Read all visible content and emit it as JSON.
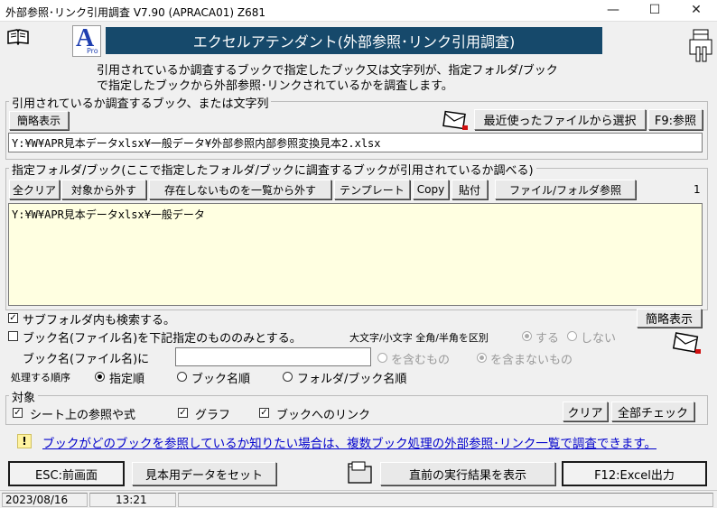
{
  "window": {
    "title": "外部参照･リンク引用調査 V7.90 (APRACA01)  Z681",
    "minimize": "—",
    "maximize": "☐",
    "close": "✕"
  },
  "header": {
    "logo_letter": "A",
    "logo_sub": "Pro",
    "banner": "エクセルアテンダント(外部参照･リンク引用調査)",
    "description_line1": "引用されているか調査するブックで指定したブック又は文字列が、指定フォルダ/ブック",
    "description_line2": "で指定したブックから外部参照･リンクされているかを調査します。"
  },
  "target_section": {
    "legend": "引用されているか調査するブック、または文字列",
    "simple_view_label": "簡略表示",
    "recent_files_label": "最近使ったファイルから選択",
    "browse_label": "F9:参照",
    "path_value": "Y:¥W¥APR見本データxlsx¥一般データ¥外部参照内部参照変換見本2.xlsx"
  },
  "folder_section": {
    "legend": "指定フォルダ/ブック(ここで指定したフォルダ/ブックに調査するブックが引用されているか調べる)",
    "buttons": {
      "clear_all": "全クリア",
      "remove_target": "対象から外す",
      "remove_missing": "存在しないものを一覧から外す",
      "template": "テンプレート",
      "copy": "Copy",
      "paste": "貼付",
      "file_folder_browse": "ファイル/フォルダ参照"
    },
    "count": "1",
    "list_items": [
      "Y:¥W¥APR見本データxlsx¥一般データ"
    ]
  },
  "options": {
    "search_subfolders": "サブフォルダ内も検索する。",
    "search_subfolders_checked": true,
    "filter_by_name": "ブック名(ファイル名)を下記指定のもののみとする。",
    "filter_by_name_checked": false,
    "case_label": "大文字/小文字 全角/半角を区別",
    "case_yes": "する",
    "case_no": "しない",
    "simple_view_label": "簡略表示",
    "book_name_label": "ブック名(ファイル名)に",
    "book_name_value": "",
    "include_label": "を含むもの",
    "exclude_label": "を含まないもの",
    "order_label": "処理する順序",
    "order_specified": "指定順",
    "order_book_name": "ブック名順",
    "order_folder_book": "フォルダ/ブック名順"
  },
  "targets": {
    "legend": "対象",
    "sheet_refs": "シート上の参照や式",
    "graph": "グラフ",
    "book_links": "ブックへのリンク",
    "clear_label": "クリア",
    "check_all_label": "全部チェック"
  },
  "info": {
    "icon": "!",
    "link_text": "ブックがどのブックを参照しているか知りたい場合は、複数ブック処理の外部参照･リンク一覧で調査できます。"
  },
  "footer": {
    "esc_label": "ESC:前画面",
    "sample_data_label": "見本用データをセット",
    "show_last_results_label": "直前の実行結果を表示",
    "excel_output_label": "F12:Excel出力"
  },
  "status": {
    "date": "2023/08/16",
    "time": "13:21"
  },
  "colors": {
    "banner_bg": "#16496b",
    "banner_text": "#ffffff",
    "list_bg": "#ffffe1",
    "link_text": "#0000cc",
    "info_icon_bg": "#fff3a0"
  },
  "icons": {
    "book": "book-icon",
    "printer": "printer-icon",
    "envelope": "envelope-icon",
    "folder": "folder-icon",
    "info": "info-icon",
    "app_logo": "app-logo-icon"
  }
}
